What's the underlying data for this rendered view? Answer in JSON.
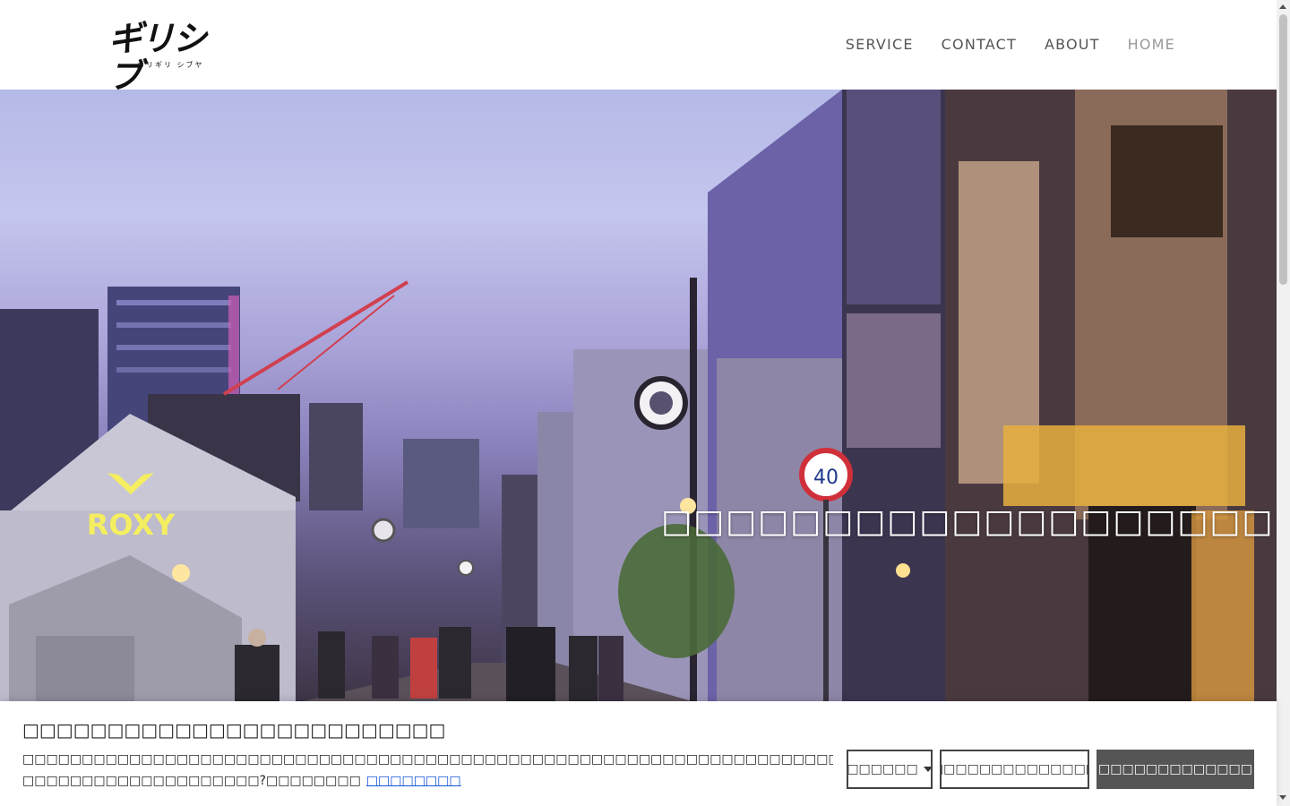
{
  "header": {
    "logo_text": "ギリシブ",
    "logo_subtext": "ギリギリ シブヤ",
    "nav": [
      {
        "label": "SERVICE",
        "active": false
      },
      {
        "label": "CONTACT",
        "active": false
      },
      {
        "label": "ABOUT",
        "active": false
      },
      {
        "label": "HOME",
        "active": true
      }
    ]
  },
  "hero": {
    "title": "□□□□□□□□□□□□□□□□□□□□□□□□□",
    "signs": {
      "roxy": "ROXY",
      "speed_limit": "40"
    }
  },
  "cookie_banner": {
    "title": "□□□□□□□□□□□□□□□□□□□□□□□□□",
    "text_line1": "□□□□□□□□□□□□□□□□□□□□□□□□□□□□□□□□□□□□□□□□□□□□□□□□□□□□□□□□□□□□□□□□□□□□□□□□□□□□□□□",
    "text_line2": "□□□□□□□□□□□□□□□□□□□□?□□□□□□□□",
    "link_text": "□□□□□□□□",
    "settings_label": "□□□□□□",
    "reject_label": "□□□□□□□□□□□□□□",
    "accept_label": "□□□□□□□□□□□□□□□"
  },
  "colors": {
    "accept_button": "#555555",
    "link": "#1a56d6",
    "nav_active": "#999999"
  }
}
